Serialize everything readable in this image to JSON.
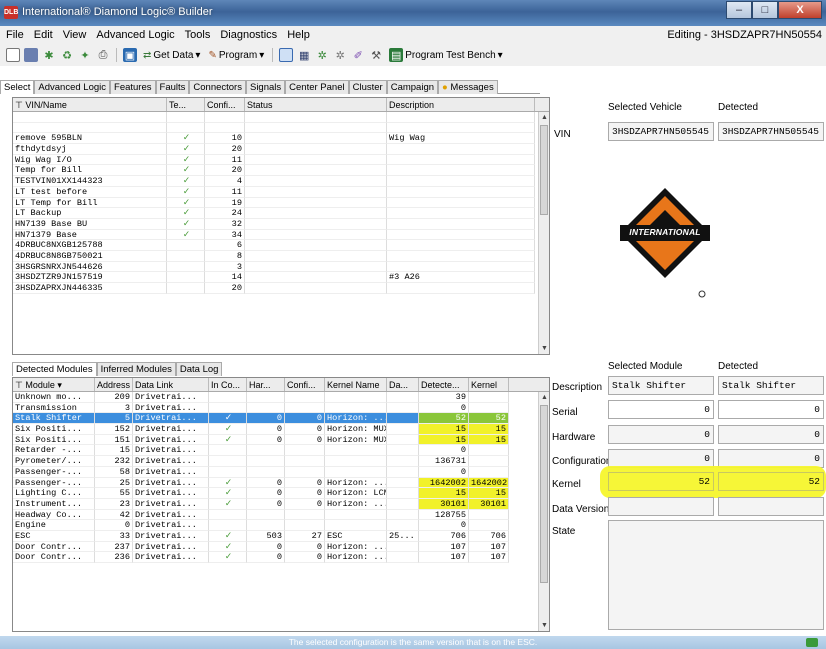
{
  "window": {
    "app_icon": "DLB",
    "title": "International® Diamond Logic® Builder",
    "minimize": "–",
    "maximize": "□",
    "close": "X"
  },
  "menu": [
    "File",
    "Edit",
    "View",
    "Advanced Logic",
    "Tools",
    "Diagnostics",
    "Help"
  ],
  "editing": "Editing - 3HSDZAPR7HN50554",
  "toolbar": {
    "get_data": "Get Data",
    "program": "Program",
    "program_test_bench": "Program Test Bench"
  },
  "tabs": [
    "Select",
    "Advanced Logic",
    "Features",
    "Faults",
    "Connectors",
    "Signals",
    "Center Panel",
    "Cluster",
    "Campaign",
    "Messages"
  ],
  "vin_grid": {
    "headers": [
      "VIN/Name",
      "Te...",
      "Confi...",
      "Status",
      "Description"
    ],
    "rows": [
      {
        "name": "",
        "te": "",
        "conf": "",
        "status": "",
        "desc": ""
      },
      {
        "name": "",
        "te": "",
        "conf": "",
        "status": "",
        "desc": ""
      },
      {
        "name": "remove 595BLN",
        "te": "✓",
        "conf": "10",
        "status": "",
        "desc": "Wig Wag"
      },
      {
        "name": "fthdytdsyj",
        "te": "✓",
        "conf": "20",
        "status": "",
        "desc": ""
      },
      {
        "name": "Wig Wag I/O",
        "te": "✓",
        "conf": "11",
        "status": "",
        "desc": ""
      },
      {
        "name": "Temp for Bill",
        "te": "✓",
        "conf": "20",
        "status": "",
        "desc": ""
      },
      {
        "name": "TESTVIN01XX144323",
        "te": "✓",
        "conf": "4",
        "status": "",
        "desc": ""
      },
      {
        "name": "LT test before",
        "te": "✓",
        "conf": "11",
        "status": "",
        "desc": ""
      },
      {
        "name": "LT Temp for Bill",
        "te": "✓",
        "conf": "19",
        "status": "",
        "desc": ""
      },
      {
        "name": "LT Backup",
        "te": "✓",
        "conf": "24",
        "status": "",
        "desc": ""
      },
      {
        "name": "HN7139 Base BU",
        "te": "✓",
        "conf": "32",
        "status": "",
        "desc": ""
      },
      {
        "name": "HN71379 Base",
        "te": "✓",
        "conf": "34",
        "status": "",
        "desc": ""
      },
      {
        "name": "4DRBUC8NXGB125788",
        "te": "",
        "conf": "6",
        "status": "",
        "desc": ""
      },
      {
        "name": "4DRBUC8N8GB750021",
        "te": "",
        "conf": "8",
        "status": "",
        "desc": ""
      },
      {
        "name": "3HSGRSNRXJN544626",
        "te": "",
        "conf": "3",
        "status": "",
        "desc": ""
      },
      {
        "name": "3HSDZTZR9JN157519",
        "te": "",
        "conf": "14",
        "status": "",
        "desc": "#3 A26"
      },
      {
        "name": "3HSDZAPRXJN446335",
        "te": "",
        "conf": "20",
        "status": "",
        "desc": ""
      }
    ]
  },
  "vehicle": {
    "selected_label": "Selected Vehicle",
    "detected_label": "Detected",
    "vin_label": "VIN",
    "vin_selected": "3HSDZAPR7HN505545",
    "vin_detected": "3HSDZAPR7HN505545",
    "logo_text": "INTERNATIONAL"
  },
  "bottom_tabs": [
    "Detected Modules",
    "Inferred Modules",
    "Data Log"
  ],
  "module_grid": {
    "headers": [
      "Module",
      "Address",
      "Data Link",
      "In Co...",
      "Har...",
      "Confi...",
      "Kernel Name",
      "Da...",
      "Detecte...",
      "Kernel"
    ],
    "rows": [
      {
        "m": "Unknown mo...",
        "a": "209",
        "d": "Drivetrai...",
        "i": "",
        "h": "",
        "c": "",
        "k": "",
        "da": "",
        "det": "39",
        "ker": ""
      },
      {
        "m": "Transmission",
        "a": "3",
        "d": "Drivetrai...",
        "i": "",
        "h": "",
        "c": "",
        "k": "",
        "da": "",
        "det": "0",
        "ker": ""
      },
      {
        "m": "Stalk Shifter",
        "a": "5",
        "d": "Drivetrai...",
        "i": "✓",
        "h": "0",
        "c": "0",
        "k": "Horizon: ...",
        "da": "",
        "det": "52",
        "ker": "52"
      },
      {
        "m": "Six Positi...",
        "a": "152",
        "d": "Drivetrai...",
        "i": "✓",
        "h": "0",
        "c": "0",
        "k": "Horizon: MUX",
        "da": "",
        "det": "15",
        "ker": "15"
      },
      {
        "m": "Six Positi...",
        "a": "151",
        "d": "Drivetrai...",
        "i": "✓",
        "h": "0",
        "c": "0",
        "k": "Horizon: MUX",
        "da": "",
        "det": "15",
        "ker": "15"
      },
      {
        "m": "Retarder -...",
        "a": "15",
        "d": "Drivetrai...",
        "i": "",
        "h": "",
        "c": "",
        "k": "",
        "da": "",
        "det": "0",
        "ker": ""
      },
      {
        "m": "Pyrometer/...",
        "a": "232",
        "d": "Drivetrai...",
        "i": "",
        "h": "",
        "c": "",
        "k": "",
        "da": "",
        "det": "136731",
        "ker": ""
      },
      {
        "m": "Passenger-...",
        "a": "58",
        "d": "Drivetrai...",
        "i": "",
        "h": "",
        "c": "",
        "k": "",
        "da": "",
        "det": "0",
        "ker": ""
      },
      {
        "m": "Passenger-...",
        "a": "25",
        "d": "Drivetrai...",
        "i": "✓",
        "h": "0",
        "c": "0",
        "k": "Horizon: ...",
        "da": "",
        "det": "1642002",
        "ker": "1642002"
      },
      {
        "m": "Lighting C...",
        "a": "55",
        "d": "Drivetrai...",
        "i": "✓",
        "h": "0",
        "c": "0",
        "k": "Horizon: LCM",
        "da": "",
        "det": "15",
        "ker": "15"
      },
      {
        "m": "Instrument...",
        "a": "23",
        "d": "Drivetrai...",
        "i": "✓",
        "h": "0",
        "c": "0",
        "k": "Horizon: ...",
        "da": "",
        "det": "30101",
        "ker": "30101"
      },
      {
        "m": "Headway Co...",
        "a": "42",
        "d": "Drivetrai...",
        "i": "",
        "h": "",
        "c": "",
        "k": "",
        "da": "",
        "det": "128755",
        "ker": ""
      },
      {
        "m": "Engine",
        "a": "0",
        "d": "Drivetrai...",
        "i": "",
        "h": "",
        "c": "",
        "k": "",
        "da": "",
        "det": "0",
        "ker": ""
      },
      {
        "m": "ESC",
        "a": "33",
        "d": "Drivetrai...",
        "i": "✓",
        "h": "503",
        "c": "27",
        "k": "ESC",
        "da": "25...",
        "det": "706",
        "ker": "706"
      },
      {
        "m": "Door Contr...",
        "a": "237",
        "d": "Drivetrai...",
        "i": "✓",
        "h": "0",
        "c": "0",
        "k": "Horizon: ...",
        "da": "",
        "det": "107",
        "ker": "107"
      },
      {
        "m": "Door Contr...",
        "a": "236",
        "d": "Drivetrai...",
        "i": "✓",
        "h": "0",
        "c": "0",
        "k": "Horizon: ...",
        "da": "",
        "det": "107",
        "ker": "107"
      }
    ]
  },
  "module": {
    "selected_label": "Selected Module",
    "detected_label": "Detected",
    "description_label": "Description",
    "description_selected": "Stalk Shifter",
    "description_detected": "Stalk Shifter",
    "serial_label": "Serial",
    "serial_selected": "0",
    "serial_detected": "0",
    "hardware_label": "Hardware",
    "hardware_selected": "0",
    "hardware_detected": "0",
    "configuration_label": "Configuration",
    "configuration_selected": "0",
    "configuration_detected": "0",
    "kernel_label": "Kernel",
    "kernel_selected": "52",
    "kernel_detected": "52",
    "data_version_label": "Data Version",
    "state_label": "State"
  },
  "status": "The selected configuration is the same version that is on the ESC."
}
